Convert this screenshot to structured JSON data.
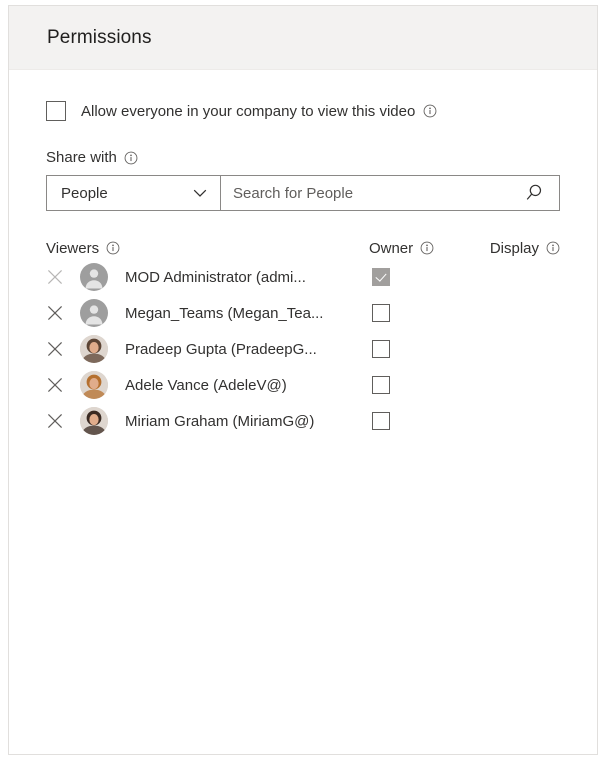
{
  "panel": {
    "title": "Permissions"
  },
  "allow_everyone": {
    "label": "Allow everyone in your company to view this video",
    "checked": false,
    "info_icon": "info-icon"
  },
  "share_with": {
    "label": "Share with",
    "info_icon": "info-icon",
    "dropdown": {
      "selected": "People",
      "options": [
        "People"
      ],
      "chevron_icon": "chevron-down-icon"
    },
    "search": {
      "value": "",
      "placeholder": "Search for People",
      "icon": "search-icon"
    }
  },
  "table": {
    "headers": {
      "viewers": "Viewers",
      "owner": "Owner",
      "display": "Display"
    },
    "remove_icon": "close-icon",
    "rows": [
      {
        "name": "MOD Administrator (admi...",
        "avatar_type": "silhouette",
        "avatar_color": "#9e9e9e",
        "owner_checked": true,
        "owner_disabled": true,
        "remove_disabled": true
      },
      {
        "name": "Megan_Teams (Megan_Tea...",
        "avatar_type": "silhouette",
        "avatar_color": "#9e9e9e",
        "owner_checked": false,
        "owner_disabled": false,
        "remove_disabled": false
      },
      {
        "name": "Pradeep Gupta (PradeepG...",
        "avatar_type": "photo",
        "avatar_color": "#5c4434",
        "owner_checked": false,
        "owner_disabled": false,
        "remove_disabled": false
      },
      {
        "name": "Adele Vance (AdeleV@)",
        "avatar_type": "photo",
        "avatar_color": "#b5702f",
        "owner_checked": false,
        "owner_disabled": false,
        "remove_disabled": false
      },
      {
        "name": "Miriam Graham (MiriamG@)",
        "avatar_type": "photo",
        "avatar_color": "#3a2a22",
        "owner_checked": false,
        "owner_disabled": false,
        "remove_disabled": false
      }
    ]
  },
  "colors": {
    "header_bg": "#f3f2f1",
    "panel_border": "#e1dfdd",
    "text": "#323130",
    "control_border": "#8a8886",
    "checked_fill": "#a19f9d"
  }
}
